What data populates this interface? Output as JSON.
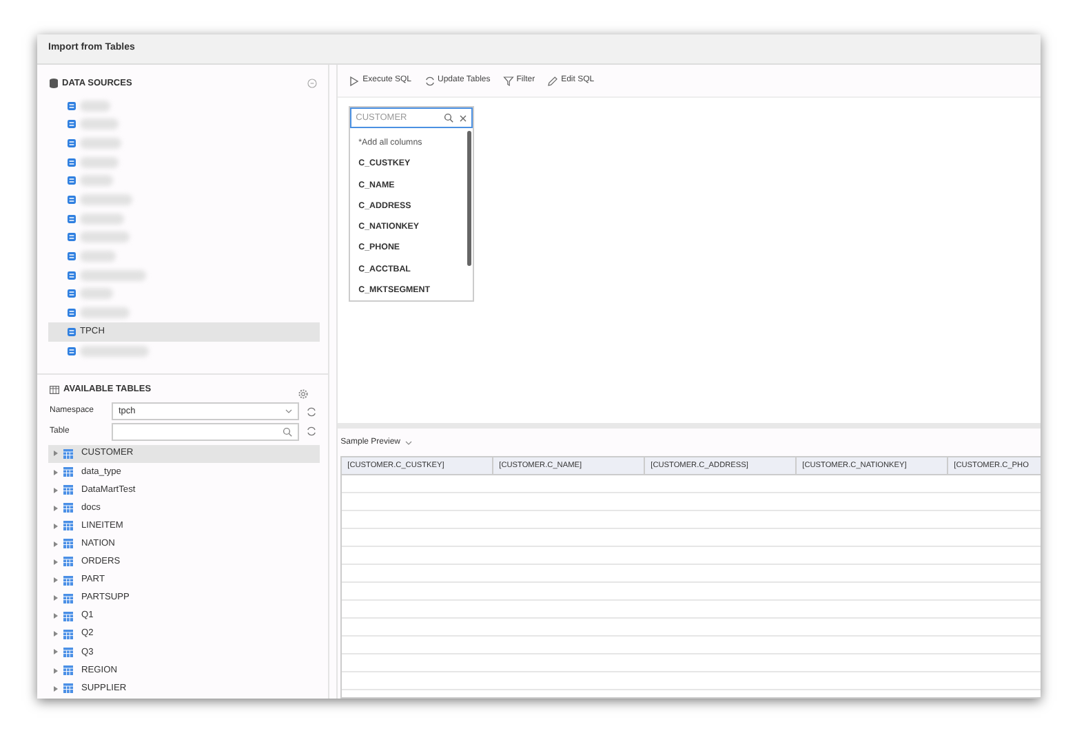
{
  "window": {
    "title": "Import from Tables"
  },
  "data_sources": {
    "title": "DATA SOURCES",
    "items": [
      {
        "redacted": true,
        "selected": false
      },
      {
        "redacted": true,
        "selected": false
      },
      {
        "redacted": true,
        "selected": false
      },
      {
        "redacted": true,
        "selected": false
      },
      {
        "redacted": true,
        "selected": false
      },
      {
        "redacted": true,
        "selected": false
      },
      {
        "redacted": true,
        "selected": false
      },
      {
        "redacted": true,
        "selected": false
      },
      {
        "redacted": true,
        "selected": false
      },
      {
        "redacted": true,
        "selected": false
      },
      {
        "redacted": true,
        "selected": false
      },
      {
        "redacted": true,
        "selected": false
      },
      {
        "name": "TPCH",
        "redacted": false,
        "selected": true
      },
      {
        "redacted": true,
        "selected": false
      }
    ]
  },
  "available_tables": {
    "title": "AVAILABLE TABLES",
    "namespace_label": "Namespace",
    "namespace_value": "tpch",
    "table_label": "Table",
    "tables": [
      {
        "name": "CUSTOMER",
        "selected": true
      },
      {
        "name": "data_type",
        "selected": false
      },
      {
        "name": "DataMartTest",
        "selected": false
      },
      {
        "name": "docs",
        "selected": false
      },
      {
        "name": "LINEITEM",
        "selected": false
      },
      {
        "name": "NATION",
        "selected": false
      },
      {
        "name": "ORDERS",
        "selected": false
      },
      {
        "name": "PART",
        "selected": false
      },
      {
        "name": "PARTSUPP",
        "selected": false
      },
      {
        "name": "Q1",
        "selected": false
      },
      {
        "name": "Q2",
        "selected": false
      },
      {
        "name": "Q3",
        "selected": false
      },
      {
        "name": "REGION",
        "selected": false
      },
      {
        "name": "SUPPLIER",
        "selected": false
      }
    ]
  },
  "toolbar": [
    {
      "label": "Execute SQL",
      "kind": "play"
    },
    {
      "label": "Update Tables",
      "kind": "refresh"
    },
    {
      "label": "Filter",
      "kind": "filter"
    },
    {
      "label": "Edit SQL",
      "kind": "pencil"
    }
  ],
  "column_picker": {
    "placeholder": "CUSTOMER",
    "items": [
      {
        "label": "*Add all columns",
        "kind": "all"
      },
      {
        "label": "C_CUSTKEY",
        "kind": "column"
      },
      {
        "label": "C_NAME",
        "kind": "column"
      },
      {
        "label": "C_ADDRESS",
        "kind": "column"
      },
      {
        "label": "C_NATIONKEY",
        "kind": "column"
      },
      {
        "label": "C_PHONE",
        "kind": "column"
      },
      {
        "label": "C_ACCTBAL",
        "kind": "column"
      },
      {
        "label": "C_MKTSEGMENT",
        "kind": "column"
      }
    ]
  },
  "preview": {
    "title": "Sample Preview",
    "columns": [
      "[CUSTOMER.C_CUSTKEY]",
      "[CUSTOMER.C_NAME]",
      "[CUSTOMER.C_ADDRESS]",
      "[CUSTOMER.C_NATIONKEY]",
      "[CUSTOMER.C_PHO"
    ]
  }
}
